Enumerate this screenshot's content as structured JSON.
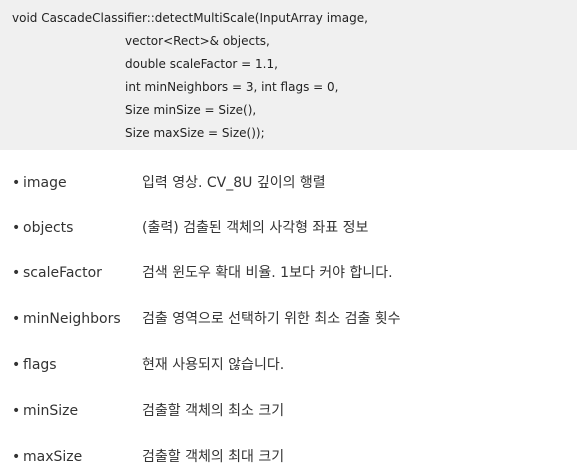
{
  "code": {
    "lines": [
      "void CascadeClassifier::detectMultiScale(InputArray image,",
      "vector<Rect>& objects,",
      "double scaleFactor = 1.1,",
      "int minNeighbors = 3, int flags = 0,",
      "Size minSize = Size(),",
      "Size maxSize = Size());"
    ]
  },
  "params": [
    {
      "bullet": "•",
      "name": "image",
      "desc": "입력 영상. CV_8U 깊이의 행렬"
    },
    {
      "bullet": "•",
      "name": "objects",
      "desc": "(출력) 검출된 객체의 사각형 좌표 정보"
    },
    {
      "bullet": "•",
      "name": "scaleFactor",
      "desc": "검색 윈도우 확대 비율. 1보다 커야 합니다."
    },
    {
      "bullet": "•",
      "name": "minNeighbors",
      "desc": "검출 영역으로 선택하기 위한 최소 검출 횟수"
    },
    {
      "bullet": "•",
      "name": "flags",
      "desc": "현재 사용되지 않습니다."
    },
    {
      "bullet": "•",
      "name": "minSize",
      "desc": "검출할 객체의 최소 크기"
    },
    {
      "bullet": "•",
      "name": "maxSize",
      "desc": "검출할 객체의 최대 크기"
    }
  ]
}
